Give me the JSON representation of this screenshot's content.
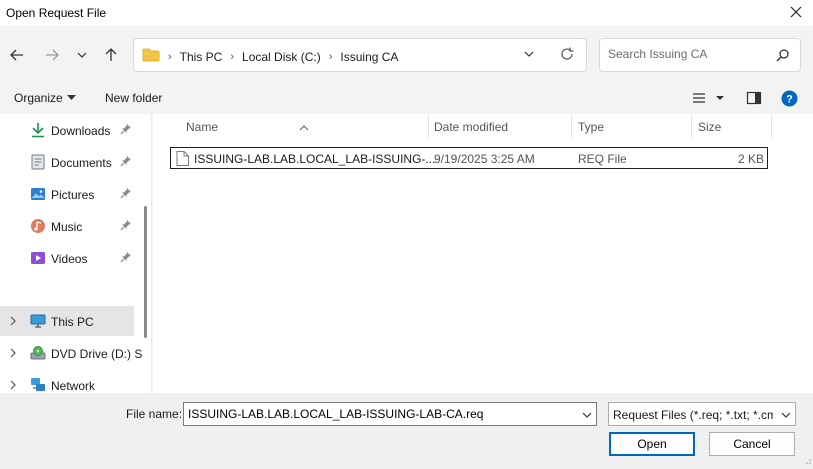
{
  "window": {
    "title": "Open Request File"
  },
  "address": {
    "crumbs": [
      "This PC",
      "Local Disk (C:)",
      "Issuing CA"
    ]
  },
  "search": {
    "placeholder": "Search Issuing CA"
  },
  "toolbar": {
    "organize_label": "Organize",
    "new_folder_label": "New folder"
  },
  "sidebar": {
    "items": [
      {
        "label": "Downloads",
        "icon": "download-icon",
        "pinned": true
      },
      {
        "label": "Documents",
        "icon": "documents-icon",
        "pinned": true
      },
      {
        "label": "Pictures",
        "icon": "pictures-icon",
        "pinned": true
      },
      {
        "label": "Music",
        "icon": "music-icon",
        "pinned": true
      },
      {
        "label": "Videos",
        "icon": "videos-icon",
        "pinned": true
      },
      {
        "label": "This PC",
        "icon": "computer-icon",
        "selected": true
      },
      {
        "label": "DVD Drive (D:) S",
        "icon": "dvd-drive-icon"
      },
      {
        "label": "Network",
        "icon": "network-icon"
      }
    ]
  },
  "columns": {
    "name": "Name",
    "date": "Date modified",
    "type": "Type",
    "size": "Size"
  },
  "files": [
    {
      "name": "ISSUING-LAB.LAB.LOCAL_LAB-ISSUING-...",
      "date": "9/19/2025 3:25 AM",
      "type": "REQ File",
      "size": "2 KB"
    }
  ],
  "footer": {
    "filename_label": "File name:",
    "filename_value": "ISSUING-LAB.LAB.LOCAL_LAB-ISSUING-LAB-CA.req",
    "filter_value": "Request Files (*.req; *.txt; *.cmc",
    "open_label": "Open",
    "cancel_label": "Cancel"
  },
  "colors": {
    "accent": "#0067c0",
    "folder": "#f4c542",
    "help": "#0067c0"
  }
}
